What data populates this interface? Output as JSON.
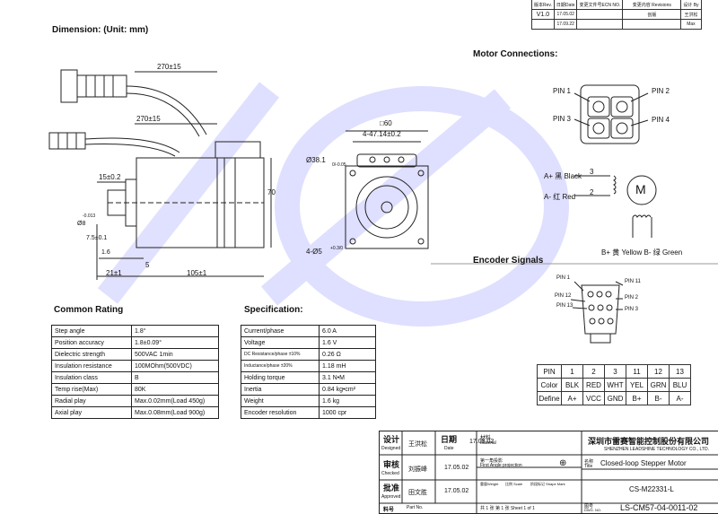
{
  "heading_dimension": "Dimension: (Unit: mm)",
  "heading_motor_connections": "Motor Connections:",
  "heading_encoder_signals": "Encoder Signals",
  "heading_common_rating": "Common Rating",
  "heading_specification": "Specification:",
  "dims": {
    "cable1": "270±15",
    "cable2": "270±15",
    "shaft_len": "15±0.2",
    "body_height": "70",
    "flange_len": "7.5±0.1",
    "d_1_6": "1.6",
    "d_5": "5",
    "d_21": "21±1",
    "body_len": "105±1",
    "square": "□60",
    "hole_spacing": "4-47.14±0.2",
    "pilot": "Ø38.1",
    "pilot_tol": "0/-0.05",
    "shaft_dia": "Ø8",
    "shaft_tol": "-0.013",
    "holes": "4-Ø5",
    "holes_tol": "+0.3/0"
  },
  "motor_pins": {
    "pin1": "PIN 1",
    "pin2": "PIN 2",
    "pin3": "PIN 3",
    "pin4": "PIN 4",
    "a_plus": "A+ 黑 Black",
    "a_minus": "A- 红 Red",
    "n3": "3",
    "n2": "2",
    "m": "M",
    "b_row": "B+ 黄 Yellow  B- 绿 Green"
  },
  "encoder_pins": {
    "p1": "PIN 1",
    "p11": "PIN 11",
    "p12": "PIN 12",
    "p13": "PIN 13",
    "p2": "PIN 2",
    "p3": "PIN 3"
  },
  "pin_table": {
    "rows": [
      [
        "PIN",
        "1",
        "2",
        "3",
        "11",
        "12",
        "13"
      ],
      [
        "Color",
        "BLK",
        "RED",
        "WHT",
        "YEL",
        "GRN",
        "BLU"
      ],
      [
        "Define",
        "A+",
        "VCC",
        "GND",
        "B+",
        "B-",
        "A-"
      ]
    ]
  },
  "common_rating": [
    [
      "Step angle",
      "1.8°"
    ],
    [
      "Position accuracy",
      "1.8±0.09°"
    ],
    [
      "Dielectric strength",
      "500VAC 1min"
    ],
    [
      "Insulation resistance",
      "100MOhm(500VDC)"
    ],
    [
      "Insulation class",
      "B"
    ],
    [
      "Temp rise(Max)",
      "80K"
    ],
    [
      "Radial play",
      "Max.0.02mm(Load 450g)"
    ],
    [
      "Axial play",
      "Max.0.08mm(Load 900g)"
    ]
  ],
  "specification": [
    [
      "Current/phase",
      "6.0 A"
    ],
    [
      "Voltage",
      "1.6 V"
    ],
    [
      "DC Resistance/phase ±10%",
      "0.26 Ω"
    ],
    [
      "Inductance/phase ±20%",
      "1.18 mH"
    ],
    [
      "Holding torque",
      "3.1 N•M"
    ],
    [
      "Inertia",
      "0.84 kg•cm²"
    ],
    [
      "Weight",
      "1.6 kg"
    ],
    [
      "Encoder resolution",
      "1000 cpr"
    ]
  ],
  "revision": {
    "headers": [
      "版本Rev.",
      "日期Date",
      "变更文件号ECN NO.",
      "变更内容 Revisions",
      "设计 By"
    ],
    "rows": [
      [
        "V1.0",
        "17.05.02",
        "",
        "创版",
        "王洪松"
      ],
      [
        "",
        "17.09.22",
        "",
        "",
        "Max"
      ]
    ]
  },
  "title_block": {
    "designed_cn": "设计",
    "designed_en": "Designed",
    "designer": "王洪松",
    "date_cn": "日期",
    "date_en": "Date",
    "date1": "17.05.02",
    "material_cn": "材料",
    "material_en": "Material",
    "company_cn": "深圳市雷赛智能控制股份有限公司",
    "company_en": "SHENZHEN LEADSHINE TECHNOLOGY CO., LTD.",
    "checked_cn": "审核",
    "checked_en": "Checked",
    "checker": "刘振峰",
    "date2": "17.05.02",
    "proj_cn": "第一角投影",
    "proj_en": "First Angle projection",
    "name_cn": "名称",
    "name_en": "Title",
    "title": "Closed-loop Stepper Motor",
    "approved_cn": "批准",
    "approved_en": "Approved",
    "approver": "田文胜",
    "date3": "17.05.02",
    "weight_lbl": "重量Weight",
    "scale_lbl": "比例 Scale",
    "shape_lbl": "阶段标记 Shape Mark",
    "model": "CS-M22331-L",
    "partno_cn": "料号",
    "partno_en": "Part No.",
    "sheet": "共 1 张 第 1 张   Sheet 1 of 1",
    "dwg_cn": "图号",
    "dwg_en": "DWG. NO.",
    "dwg_no": "LS-CM57-04-0011-02"
  }
}
